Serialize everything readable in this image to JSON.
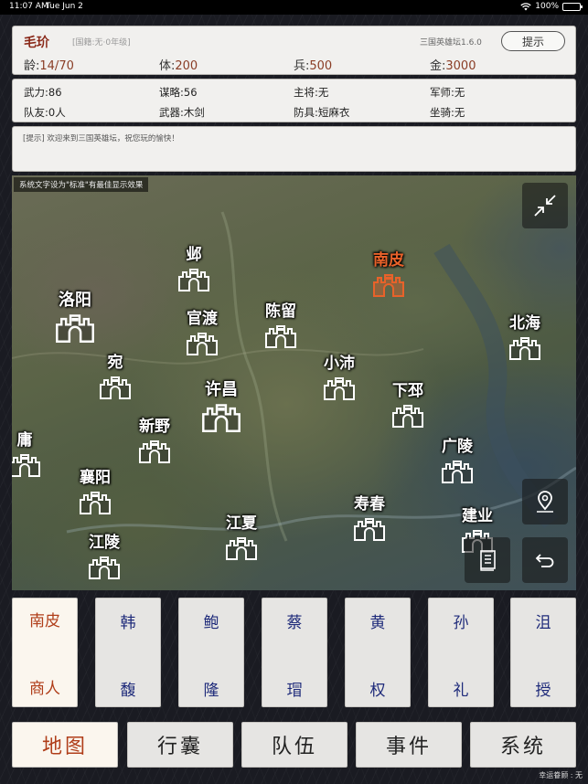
{
  "status_bar": {
    "time": "11:07 AM",
    "date": "Tue Jun 2",
    "battery": "100%"
  },
  "character": {
    "name": "毛玠",
    "faction": "[国籍:无·0年级]",
    "version": "三国英雄坛1.6.0",
    "hint_button": "提示",
    "age": {
      "label": "龄:",
      "value": "14/70"
    },
    "health": {
      "label": "体:",
      "value": "200"
    },
    "soldiers": {
      "label": "兵:",
      "value": "500"
    },
    "gold": {
      "label": "金:",
      "value": "3000"
    }
  },
  "attributes": {
    "row1": [
      {
        "label": "武力:",
        "value": "86"
      },
      {
        "label": "谋略:",
        "value": "56"
      },
      {
        "label": "主将:",
        "value": "无"
      },
      {
        "label": "军师:",
        "value": "无"
      }
    ],
    "row2": [
      {
        "label": "队友:",
        "value": "0人"
      },
      {
        "label": "武器:",
        "value": "木剑"
      },
      {
        "label": "防具:",
        "value": "短麻衣"
      },
      {
        "label": "坐骑:",
        "value": "无"
      }
    ]
  },
  "message": "[提示] 欢迎来到三国英雄坛，祝您玩的愉快！",
  "map": {
    "notice": "系统文字设为\"标准\"有最佳显示效果",
    "cities": [
      {
        "name": "邺"
      },
      {
        "name": "南皮",
        "selected": true
      },
      {
        "name": "洛阳",
        "big": true
      },
      {
        "name": "官渡"
      },
      {
        "name": "陈留"
      },
      {
        "name": "北海"
      },
      {
        "name": "宛"
      },
      {
        "name": "小沛"
      },
      {
        "name": "许昌",
        "big": true
      },
      {
        "name": "下邳"
      },
      {
        "name": "新野"
      },
      {
        "name": "庸"
      },
      {
        "name": "广陵"
      },
      {
        "name": "襄阳"
      },
      {
        "name": "寿春"
      },
      {
        "name": "江夏"
      },
      {
        "name": "建业"
      },
      {
        "name": "江陵"
      }
    ]
  },
  "merchants": [
    {
      "line1": "南皮",
      "line2": "商人",
      "active": true
    },
    {
      "line1": "韩",
      "line2": "馥"
    },
    {
      "line1": "鲍",
      "line2": "隆"
    },
    {
      "line1": "蔡",
      "line2": "瑁"
    },
    {
      "line1": "黄",
      "line2": "权"
    },
    {
      "line1": "孙",
      "line2": "礼"
    },
    {
      "line1": "沮",
      "line2": "授"
    }
  ],
  "tabs": [
    {
      "label": "地图",
      "active": true
    },
    {
      "label": "行囊"
    },
    {
      "label": "队伍"
    },
    {
      "label": "事件"
    },
    {
      "label": "系统"
    }
  ],
  "luck": "幸运眷顾 : 无"
}
